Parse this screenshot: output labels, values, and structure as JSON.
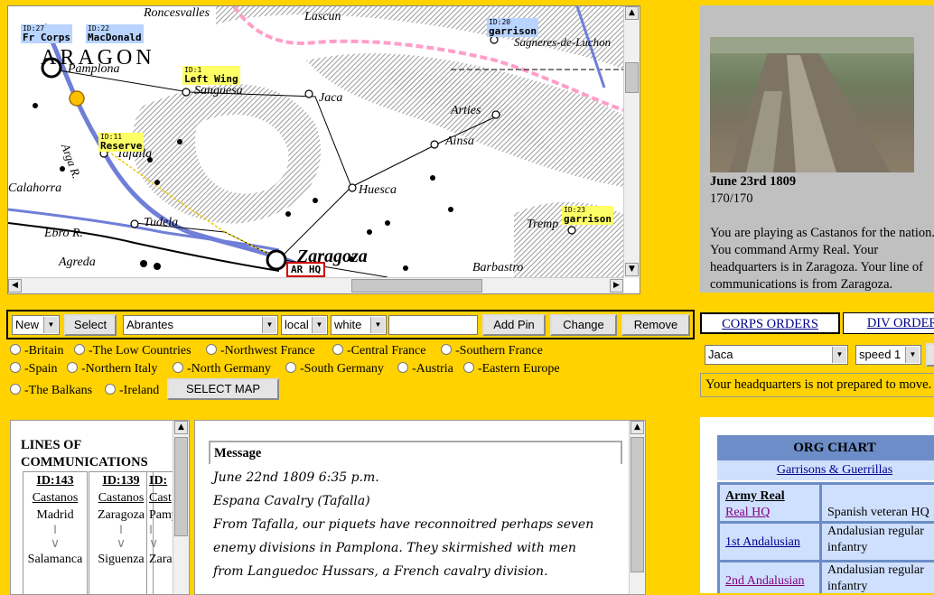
{
  "map": {
    "places": [
      {
        "name": "Roncesvalles"
      },
      {
        "name": "Lascun"
      },
      {
        "name": "Sagneres-de-Luchon"
      },
      {
        "name": "ARAGON"
      },
      {
        "name": "Pamplona"
      },
      {
        "name": "Sanguesa"
      },
      {
        "name": "Jaca"
      },
      {
        "name": "Arties"
      },
      {
        "name": "Ainsa"
      },
      {
        "name": "Tafalla"
      },
      {
        "name": "Huesca"
      },
      {
        "name": "Calahorra"
      },
      {
        "name": "Tudela"
      },
      {
        "name": "Tremp"
      },
      {
        "name": "Ebro R."
      },
      {
        "name": "Agreda"
      },
      {
        "name": "Zaragoza"
      },
      {
        "name": "Barbastro"
      },
      {
        "name": "Arga R."
      }
    ],
    "units": [
      {
        "id": "ID:27",
        "name": "Fr Corps"
      },
      {
        "id": "ID:22",
        "name": "MacDonald"
      },
      {
        "id": "ID:20",
        "name": "garrison"
      },
      {
        "id": "ID:1",
        "name": "Left Wing"
      },
      {
        "id": "ID:11",
        "name": "Reserve"
      },
      {
        "id": "ID:23",
        "name": "garrison"
      }
    ],
    "hq_label": "AR HQ"
  },
  "info": {
    "date": "June 23rd 1809",
    "score": "170/170",
    "description": "You are playing as Castanos for the nation. You command Army Real. Your headquarters is in Zaragoza. Your line of communications is from Zaragoza."
  },
  "toolbar": {
    "new_value": "New",
    "select_label": "Select",
    "location_value": "Abrantes",
    "scope_value": "local",
    "color_value": "white",
    "pin_text": "",
    "add_pin_label": "Add Pin",
    "change_label": "Change",
    "remove_label": "Remove"
  },
  "regions": [
    "-Britain",
    "-The Low Countries",
    "-Northwest France",
    "-Central France",
    "-Southern France",
    "-Spain",
    "-Northern Italy",
    "-North Germany",
    "-South Germany",
    "-Austria",
    "-Eastern Europe",
    "-The Balkans",
    "-Ireland"
  ],
  "select_map_label": "SELECT MAP",
  "orders": {
    "corps_tab": "CORPS ORDERS",
    "div_tab": "DIV ORDERS",
    "destination_value": "Jaca",
    "speed_value": "speed 1",
    "status": "Your headquarters is not prepared to move."
  },
  "loc": {
    "title_line1": "LINES OF",
    "title_line2": "COMMUNICATIONS",
    "columns": [
      {
        "id": "ID:143",
        "name": "Castanos",
        "from": "Madrid",
        "to": "Salamanca"
      },
      {
        "id": "ID:139",
        "name": "Castanos",
        "from": "Zaragoza",
        "to": "Siguenza"
      },
      {
        "id": "ID:",
        "name": "Cast",
        "from": "Pamp",
        "to": "Zara"
      }
    ]
  },
  "message": {
    "header": "Message",
    "lines": [
      "June 22nd 1809 6:35 p.m.",
      "Espana Cavalry (Tafalla)",
      "From Tafalla, our piquets have reconnoitred perhaps seven",
      "enemy divisions in Pamplona. They skirmished with men",
      "from Languedoc Hussars, a French cavalry division."
    ]
  },
  "org": {
    "title": "ORG CHART",
    "subtitle": "Garrisons & Guerrillas",
    "army_name": "Army Real",
    "rows": [
      {
        "name": "Real HQ",
        "desc": "Spanish veteran HQ"
      },
      {
        "name": "1st Andalusian",
        "desc": "Andalusian regular infantry"
      },
      {
        "name": "2nd Andalusian",
        "desc": "Andalusian regular infantry"
      }
    ]
  }
}
